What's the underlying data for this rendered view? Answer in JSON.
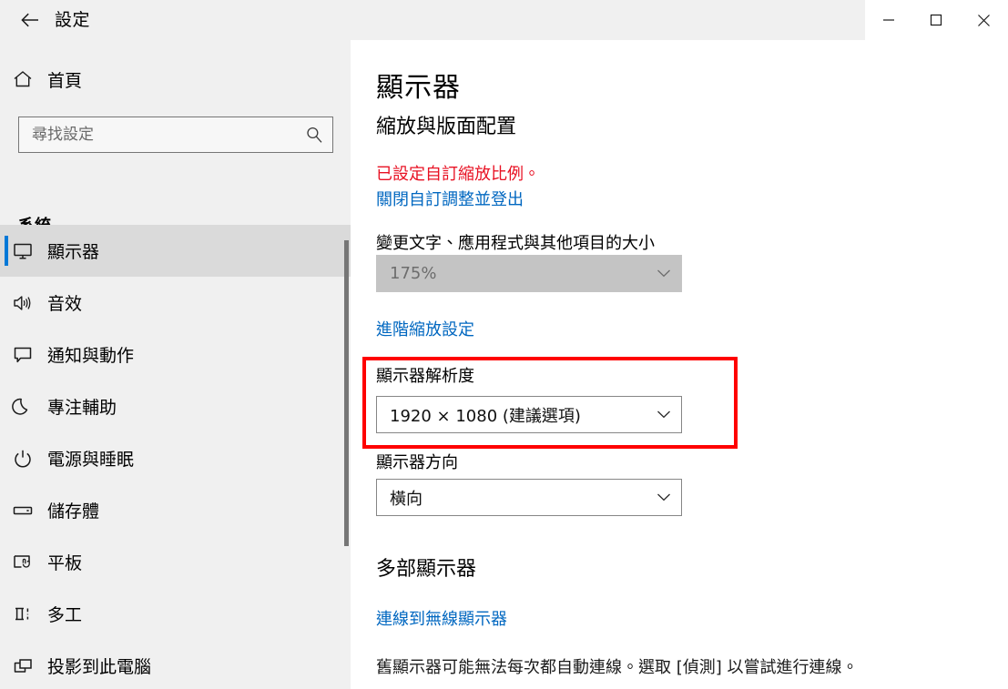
{
  "window": {
    "title": "設定",
    "back_icon": "back-arrow-icon",
    "controls": [
      {
        "name": "minimize-button",
        "icon": "minimize-icon"
      },
      {
        "name": "maximize-button",
        "icon": "maximize-icon"
      },
      {
        "name": "close-button",
        "icon": "close-icon"
      }
    ]
  },
  "sidebar": {
    "home": {
      "label": "首頁",
      "icon": "home-icon"
    },
    "search": {
      "placeholder": "尋找設定",
      "value": "",
      "icon": "search-icon"
    },
    "group_title": "系統",
    "items": [
      {
        "label": "顯示器",
        "icon": "monitor-icon",
        "selected": true
      },
      {
        "label": "音效",
        "icon": "speaker-icon",
        "selected": false
      },
      {
        "label": "通知與動作",
        "icon": "notification-icon",
        "selected": false
      },
      {
        "label": "專注輔助",
        "icon": "moon-icon",
        "selected": false
      },
      {
        "label": "電源與睡眠",
        "icon": "power-icon",
        "selected": false
      },
      {
        "label": "儲存體",
        "icon": "drive-icon",
        "selected": false
      },
      {
        "label": "平板",
        "icon": "tablet-icon",
        "selected": false
      },
      {
        "label": "多工",
        "icon": "multitasking-icon",
        "selected": false
      },
      {
        "label": "投影到此電腦",
        "icon": "project-icon",
        "selected": false
      }
    ]
  },
  "main": {
    "page_title": "顯示器",
    "scale_section_title": "縮放與版面配置",
    "warning_text": "已設定自訂縮放比例。",
    "warning_link": "關閉自訂調整並登出",
    "scale_label": "變更文字、應用程式與其他項目的大小",
    "scale_value": "175%",
    "advanced_scaling_link": "進階縮放設定",
    "resolution_label": "顯示器解析度",
    "resolution_value": "1920 × 1080 (建議選項)",
    "orientation_label": "顯示器方向",
    "orientation_value": "橫向",
    "multi_display_title": "多部顯示器",
    "wireless_link": "連線到無線顯示器",
    "multi_display_note": "舊顯示器可能無法每次都自動連線。選取 [偵測] 以嘗試進行連線。"
  },
  "colors": {
    "accent": "#0078d7",
    "link": "#0067c0",
    "warning": "#e81123",
    "annotation": "#ff0000",
    "sidebar_bg": "#f0f0f0",
    "selected_bg": "#dadada",
    "disabled_bg": "#c4c4c4"
  }
}
